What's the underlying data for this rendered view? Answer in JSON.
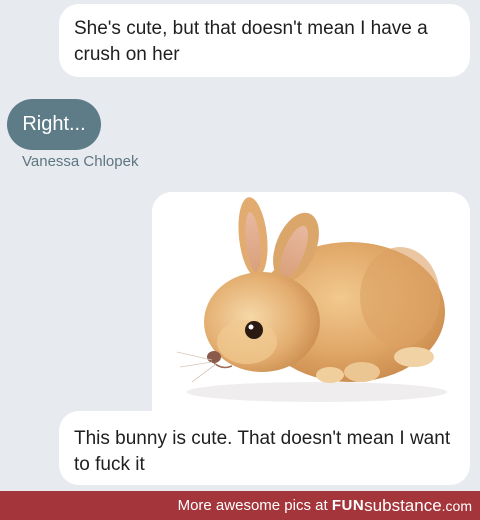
{
  "messages": [
    {
      "direction": "outgoing",
      "text": "She's cute, but that doesn't mean I have a crush on her"
    },
    {
      "direction": "incoming",
      "text": "Right...",
      "sender": "Vanessa Chlopek"
    },
    {
      "direction": "outgoing",
      "type": "image",
      "image_subject": "light orange baby bunny on white background"
    },
    {
      "direction": "outgoing",
      "text": "This bunny is cute. That doesn't mean I want to fuck it"
    }
  ],
  "footer": {
    "prefix": "More awesome pics at ",
    "brand_fun": "FUN",
    "brand_sub": "substance",
    "brand_com": ".com"
  },
  "colors": {
    "background": "#e7ebf0",
    "incoming_bubble": "#5e7b88",
    "outgoing_bubble": "#ffffff",
    "footer_bar": "#a3353b"
  }
}
